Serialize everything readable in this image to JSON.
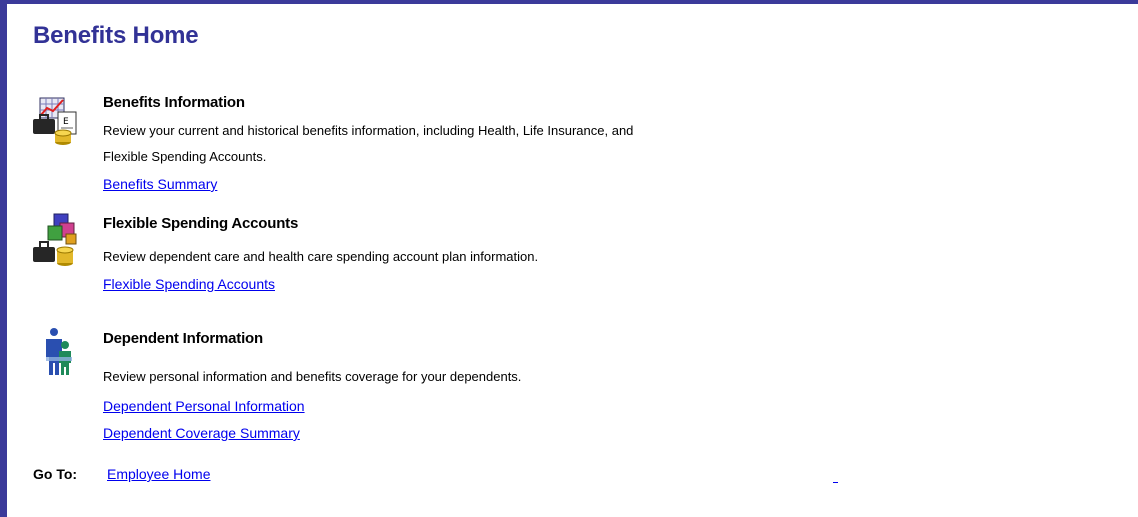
{
  "page": {
    "title": "Benefits Home"
  },
  "sections": [
    {
      "title": "Benefits Information",
      "description": "Review your current and historical benefits information, including Health, Life Insurance, and Flexible Spending Accounts.",
      "links": [
        "Benefits Summary"
      ],
      "icon": "benefits-chart-icon"
    },
    {
      "title": "Flexible Spending Accounts",
      "description": "Review dependent care and health care spending account plan information.",
      "links": [
        "Flexible Spending Accounts"
      ],
      "icon": "spending-blocks-icon"
    },
    {
      "title": "Dependent Information",
      "description": "Review personal information and benefits coverage for your dependents.",
      "links": [
        "Dependent Personal Information",
        "Dependent Coverage Summary"
      ],
      "icon": "dependents-people-icon"
    }
  ],
  "goto": {
    "label": "Go To:",
    "link": "Employee Home"
  },
  "colors": {
    "frame": "#3b3a9a",
    "title": "#323296",
    "link": "#0000ee"
  }
}
